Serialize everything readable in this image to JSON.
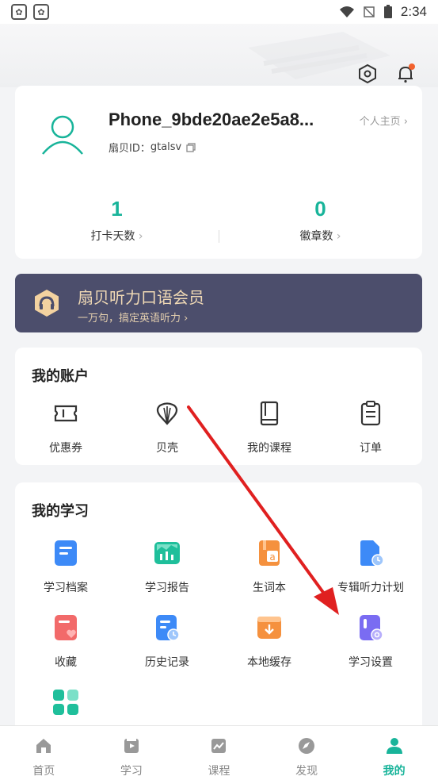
{
  "status_bar": {
    "time": "2:34"
  },
  "profile": {
    "username": "Phone_9bde20ae2e5a8...",
    "id_label": "扇贝ID：",
    "id_value": "gtalsv",
    "homepage_link": "个人主页",
    "checkin": {
      "value": "1",
      "label": "打卡天数"
    },
    "badges": {
      "value": "0",
      "label": "徽章数"
    }
  },
  "vip": {
    "title": "扇贝听力口语会员",
    "subtitle": "一万句，搞定英语听力"
  },
  "account": {
    "title": "我的账户",
    "items": [
      {
        "label": "优惠券",
        "icon": "coupon-icon"
      },
      {
        "label": "贝壳",
        "icon": "shell-icon"
      },
      {
        "label": "我的课程",
        "icon": "book-icon"
      },
      {
        "label": "订单",
        "icon": "clipboard-icon"
      }
    ]
  },
  "study": {
    "title": "我的学习",
    "items": [
      {
        "label": "学习档案",
        "icon": "study-file-icon",
        "color": "#3d8af7"
      },
      {
        "label": "学习报告",
        "icon": "study-report-icon",
        "color": "#1fbf9b"
      },
      {
        "label": "生词本",
        "icon": "vocab-book-icon",
        "color": "#f5913e"
      },
      {
        "label": "专辑听力计划",
        "icon": "listening-plan-icon",
        "color": "#3d8af7"
      },
      {
        "label": "收藏",
        "icon": "favorite-icon",
        "color": "#f26a6a"
      },
      {
        "label": "历史记录",
        "icon": "history-icon",
        "color": "#3d8af7"
      },
      {
        "label": "本地缓存",
        "icon": "local-cache-icon",
        "color": "#f5913e"
      },
      {
        "label": "学习设置",
        "icon": "study-settings-icon",
        "color": "#7a6cf2"
      },
      {
        "label": "",
        "icon": "more-apps-icon",
        "color": "#1fbf9b"
      }
    ]
  },
  "tabs": [
    {
      "label": "首页",
      "icon": "home-icon",
      "active": false
    },
    {
      "label": "学习",
      "icon": "study-icon",
      "active": false
    },
    {
      "label": "课程",
      "icon": "course-icon",
      "active": false
    },
    {
      "label": "发现",
      "icon": "discover-icon",
      "active": false
    },
    {
      "label": "我的",
      "icon": "profile-icon",
      "active": true
    }
  ],
  "colors": {
    "accent": "#18b49a",
    "vip_bg": "#4c4e6c",
    "annotation_arrow": "#e02020"
  }
}
